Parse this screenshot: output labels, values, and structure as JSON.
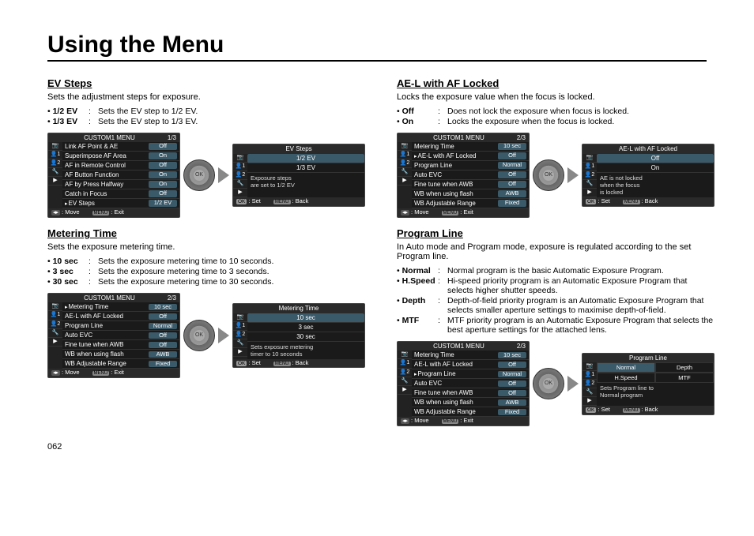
{
  "page_title": "Using the Menu",
  "page_number": "062",
  "left": {
    "ev_steps": {
      "heading": "EV Steps",
      "desc": "Sets the adjustment steps for exposure.",
      "bullets": [
        {
          "label": "1/2 EV",
          "text": "Sets the EV step to 1/2 EV."
        },
        {
          "label": "1/3 EV",
          "text": "Sets the EV step to 1/3 EV."
        }
      ],
      "menu": {
        "title": "CUSTOM1 MENU",
        "page": "1/3",
        "items": [
          {
            "name": "Link AF Point & AE",
            "val": "Off"
          },
          {
            "name": "Superimpose AF Area",
            "val": "On"
          },
          {
            "name": "AF in Remote Control",
            "val": "Off"
          },
          {
            "name": "AF Button Function",
            "val": "On"
          },
          {
            "name": "AF by Press Halfway",
            "val": "On"
          },
          {
            "name": "Catch in Focus",
            "val": "Off"
          },
          {
            "name": "EV Steps",
            "val": "1/2 EV",
            "sel": true
          }
        ],
        "foot_l": ": Move",
        "foot_r": ": Exit"
      },
      "sub": {
        "title": "EV Steps",
        "opts": [
          "1/2 EV",
          "1/3 EV"
        ],
        "sel": 0,
        "hint": "Exposure steps\nare set to 1/2 EV",
        "foot_l": ": Set",
        "foot_r": ": Back"
      }
    },
    "metering": {
      "heading": "Metering Time",
      "desc": "Sets the exposure metering time.",
      "bullets": [
        {
          "label": "10 sec",
          "text": "Sets the exposure metering time to 10 seconds."
        },
        {
          "label": "3 sec",
          "text": "Sets the exposure metering time to 3 seconds."
        },
        {
          "label": "30 sec",
          "text": "Sets the exposure metering time to 30 seconds."
        }
      ],
      "menu": {
        "title": "CUSTOM1 MENU",
        "page": "2/3",
        "items": [
          {
            "name": "Metering Time",
            "val": "10 sec",
            "sel": true
          },
          {
            "name": "AE-L with AF Locked",
            "val": "Off"
          },
          {
            "name": "Program Line",
            "val": "Normal"
          },
          {
            "name": "Auto EVC",
            "val": "Off"
          },
          {
            "name": "Fine tune when AWB",
            "val": "Off"
          },
          {
            "name": "WB when using flash",
            "val": "AWB"
          },
          {
            "name": "WB Adjustable Range",
            "val": "Fixed"
          }
        ],
        "foot_l": ": Move",
        "foot_r": ": Exit"
      },
      "sub": {
        "title": "Metering Time",
        "opts": [
          "10 sec",
          "3 sec",
          "30 sec"
        ],
        "sel": 0,
        "hint": "Sets exposure metering\ntimer to 10 seconds",
        "foot_l": ": Set",
        "foot_r": ": Back"
      }
    }
  },
  "right": {
    "ael": {
      "heading": "AE-L with AF Locked",
      "desc": "Locks the exposure value when the focus is locked.",
      "bullets": [
        {
          "label": "Off",
          "text": "Does not lock the exposure when focus is locked."
        },
        {
          "label": "On",
          "text": "Locks the exposure when the focus is locked."
        }
      ],
      "menu": {
        "title": "CUSTOM1 MENU",
        "page": "2/3",
        "items": [
          {
            "name": "Metering Time",
            "val": "10 sec"
          },
          {
            "name": "AE-L with AF Locked",
            "val": "Off",
            "sel": true
          },
          {
            "name": "Program Line",
            "val": "Normal"
          },
          {
            "name": "Auto EVC",
            "val": "Off"
          },
          {
            "name": "Fine tune when AWB",
            "val": "Off"
          },
          {
            "name": "WB when using flash",
            "val": "AWB"
          },
          {
            "name": "WB Adjustable Range",
            "val": "Fixed"
          }
        ],
        "foot_l": ": Move",
        "foot_r": ": Exit"
      },
      "sub": {
        "title": "AE-L with AF Locked",
        "opts": [
          "Off",
          "On"
        ],
        "sel": 0,
        "hint": "AE is not locked\nwhen the focus\nis locked",
        "foot_l": ": Set",
        "foot_r": ": Back"
      }
    },
    "program": {
      "heading": "Program Line",
      "desc": "In Auto mode and Program mode, exposure is regulated according to the set Program line.",
      "bullets": [
        {
          "label": "Normal",
          "text": "Normal program is the basic Automatic Exposure Program."
        },
        {
          "label": "H.Speed",
          "text": "Hi-speed priority program is an Automatic Exposure Program that selects higher shutter speeds."
        },
        {
          "label": "Depth",
          "text": "Depth-of-field priority program is an Automatic Exposure Program that selects smaller aperture settings to maximise depth-of-field."
        },
        {
          "label": "MTF",
          "text": "MTF priority program is an Automatic Exposure Program that selects the best aperture settings for the attached lens."
        }
      ],
      "menu": {
        "title": "CUSTOM1 MENU",
        "page": "2/3",
        "items": [
          {
            "name": "Metering Time",
            "val": "10 sec"
          },
          {
            "name": "AE-L with AF Locked",
            "val": "Off"
          },
          {
            "name": "Program Line",
            "val": "Normal",
            "sel": true
          },
          {
            "name": "Auto EVC",
            "val": "Off"
          },
          {
            "name": "Fine tune when AWB",
            "val": "Off"
          },
          {
            "name": "WB when using flash",
            "val": "AWB"
          },
          {
            "name": "WB Adjustable Range",
            "val": "Fixed"
          }
        ],
        "foot_l": ": Move",
        "foot_r": ": Exit"
      },
      "sub": {
        "title": "Program Line",
        "grid": [
          [
            "Normal",
            "Depth"
          ],
          [
            "H.Speed",
            "MTF"
          ]
        ],
        "sel": "Normal",
        "hint": "Sets Program line to\nNormal program",
        "foot_l": ": Set",
        "foot_r": ": Back"
      }
    }
  },
  "tabs": [
    "📷",
    "👤1",
    "👤2",
    "🔧",
    "▶"
  ]
}
